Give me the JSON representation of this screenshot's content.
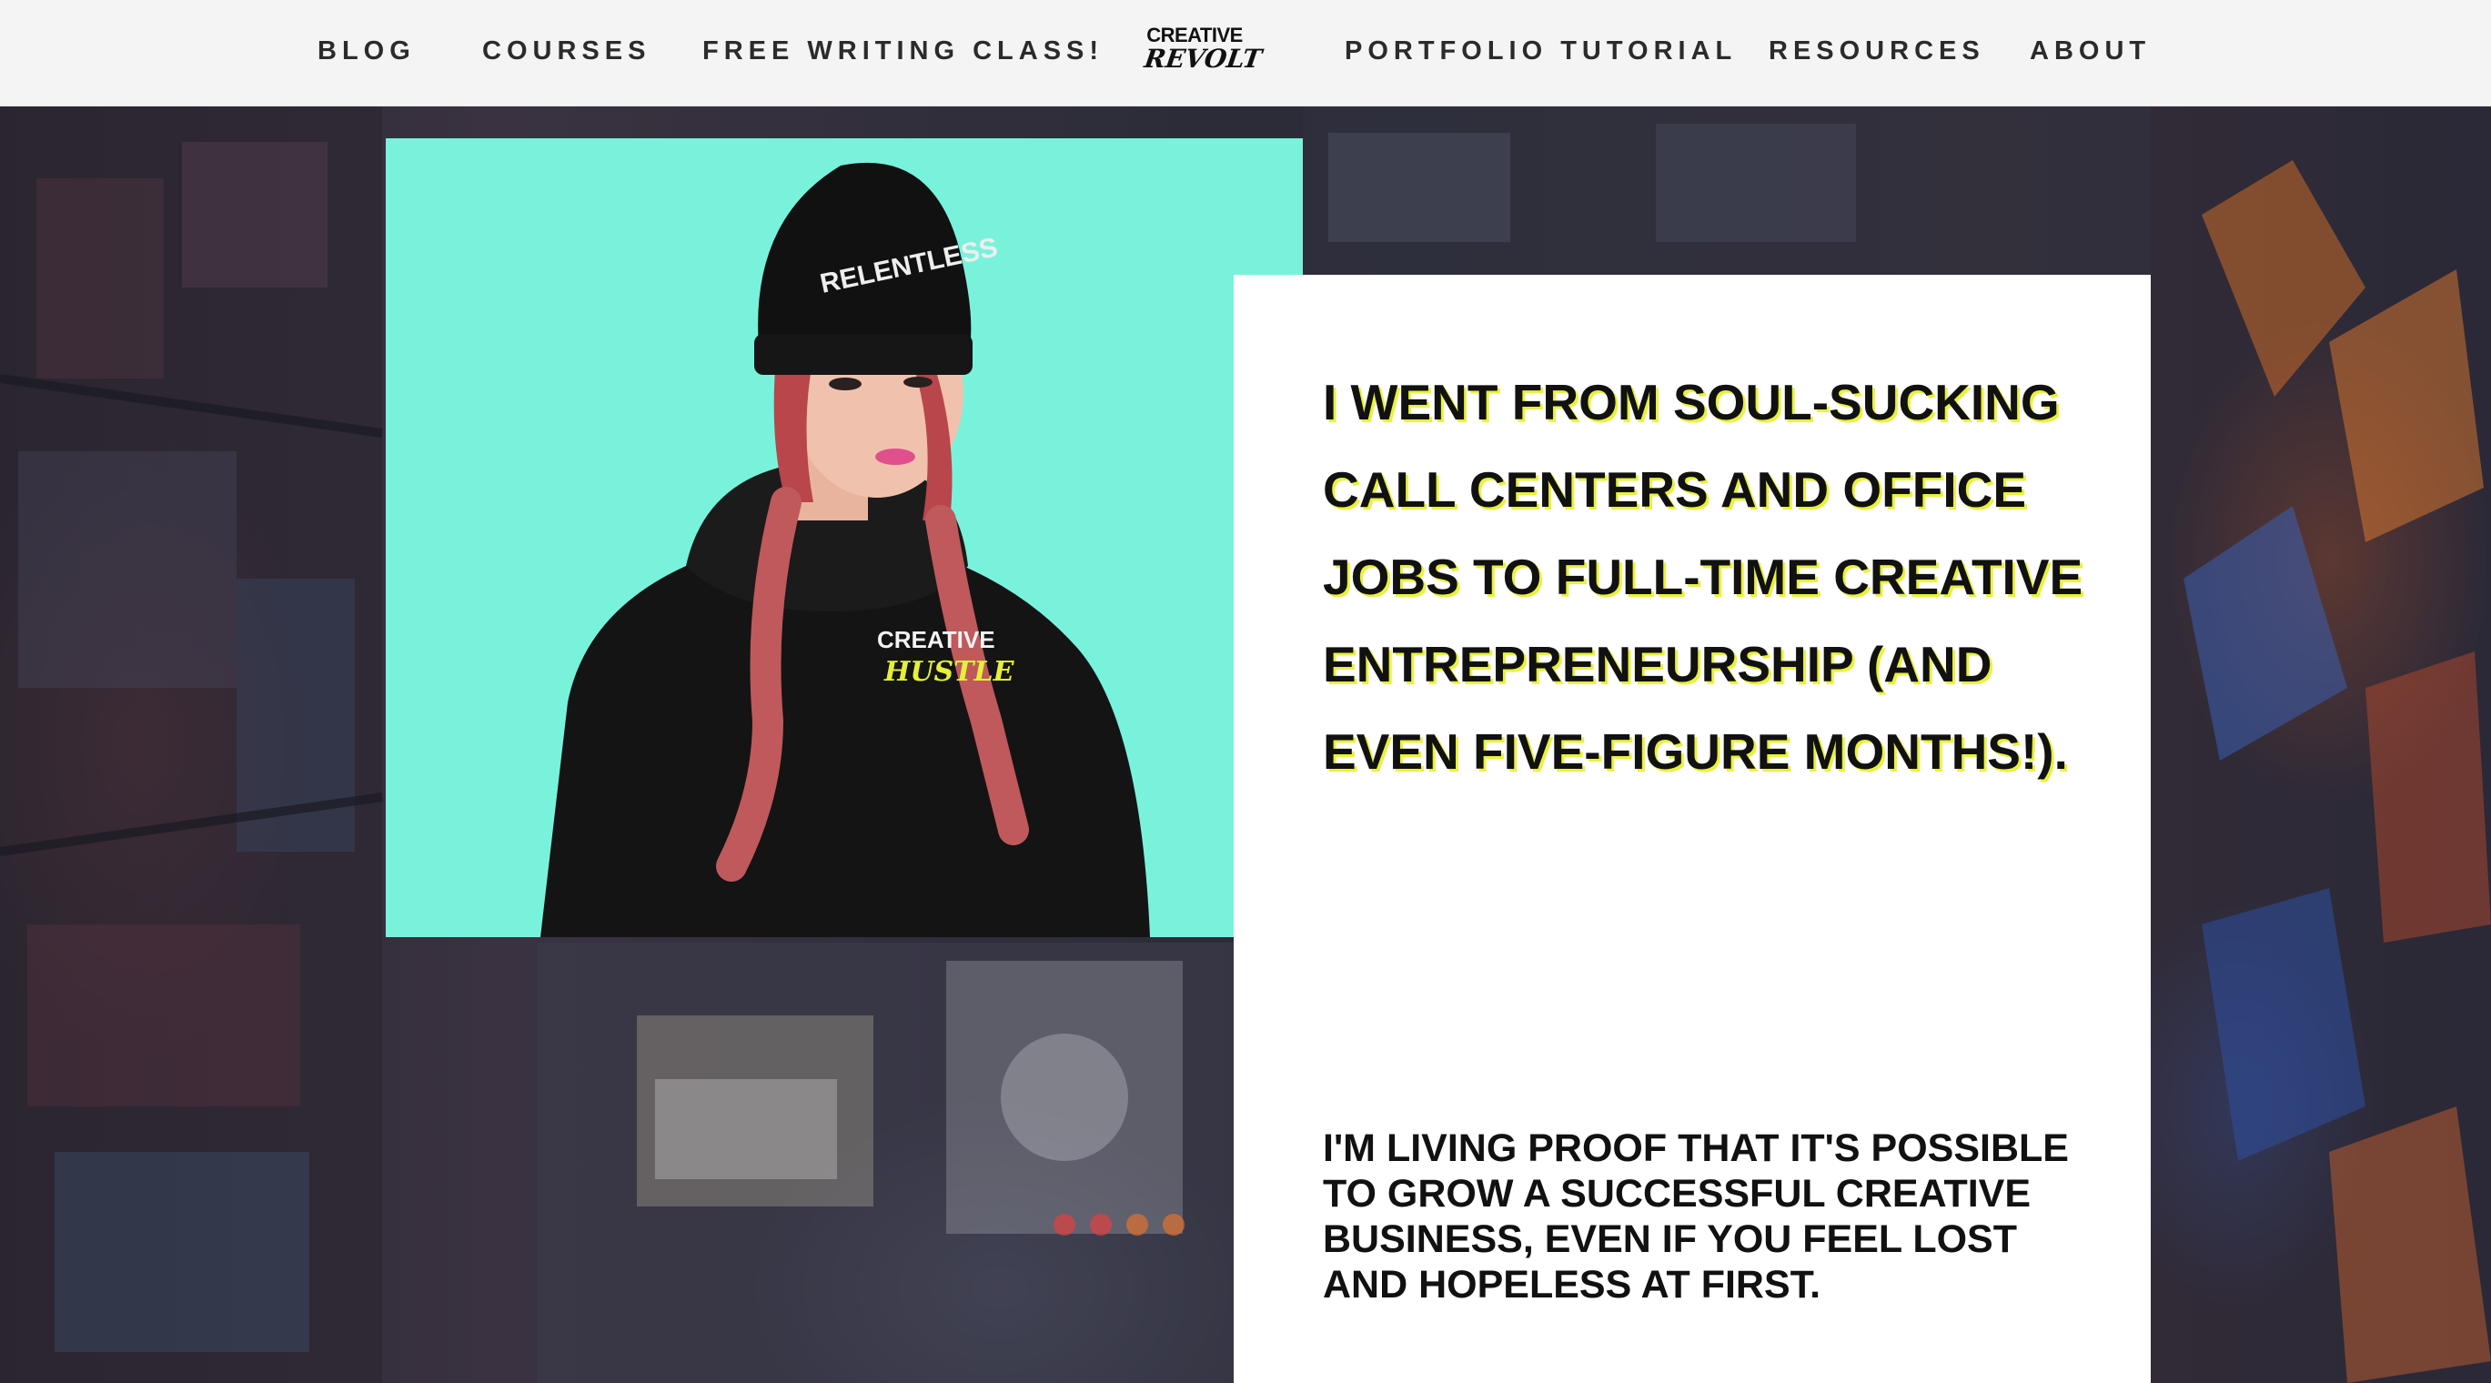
{
  "nav": {
    "items": [
      {
        "label": "BLOG"
      },
      {
        "label": "COURSES"
      },
      {
        "label": "FREE WRITING CLASS!"
      },
      {
        "label": "PORTFOLIO TUTORIAL"
      },
      {
        "label": "RESOURCES"
      },
      {
        "label": "ABOUT"
      }
    ],
    "logo": {
      "top": "CREATIVE",
      "bottom": "REVOLT"
    }
  },
  "hero": {
    "photo": {
      "beanie_text": "RELENTLESS",
      "hoodie_text_top": "CREATIVE",
      "hoodie_text_bottom": "HUSTLE"
    },
    "headline": "I went from soul-sucking call centers and office jobs to full-time creative entrepreneurship (and even five-figure months!).",
    "subheadline": "I'm living proof that it's possible to grow a successful creative business, even if you feel lost and hopeless at first."
  },
  "colors": {
    "nav_bg": "#f4f4f4",
    "photo_bg": "#79f2dc",
    "card_bg": "#ffffff",
    "headline_shadow": "#e9f23a",
    "text": "#111111"
  }
}
